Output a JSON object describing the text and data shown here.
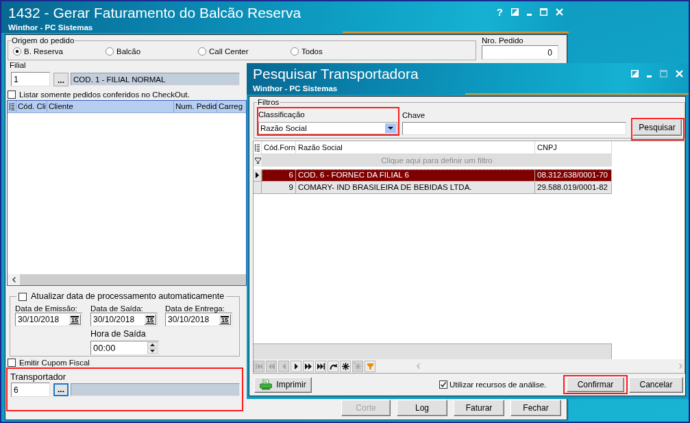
{
  "main_window": {
    "title": "1432 - Gerar Faturamento do Balcão Reserva",
    "subtitle": "Winthor - PC Sistemas",
    "controls": [
      {
        "kind": "help",
        "glyph": "?",
        "disabled": false
      },
      {
        "kind": "restore",
        "disabled": false
      },
      {
        "kind": "minimize",
        "disabled": false
      },
      {
        "kind": "maximize",
        "disabled": false
      },
      {
        "kind": "close",
        "disabled": false
      }
    ]
  },
  "origin": {
    "legend": "Origem do pedido",
    "options": [
      {
        "label": "B. Reserva",
        "selected": true
      },
      {
        "label": "Balcão",
        "selected": false
      },
      {
        "label": "Call Center",
        "selected": false
      },
      {
        "label": "Todos",
        "selected": false
      }
    ]
  },
  "order_number": {
    "label": "Nro. Pedido",
    "value": "0"
  },
  "branch": {
    "label": "Filial",
    "value": "1",
    "lookup": "...",
    "description": "COD. 1 - FILIAL NORMAL"
  },
  "checkout_filter": {
    "label": "Listar somente pedidos conferidos no CheckOut.",
    "checked": false
  },
  "orders_table": {
    "columns": [
      "Cód. Cli",
      "Cliente",
      "Num. Pedid",
      "Carreg"
    ]
  },
  "auto_dates": {
    "label": "Atualizar data de processamento automaticamente",
    "checked": false,
    "dates": [
      {
        "label": "Data de Emissão:",
        "value": "30/10/2018",
        "calendar": "15"
      },
      {
        "label": "Data de Saída:",
        "value": "30/10/2018",
        "calendar": "15"
      },
      {
        "label": "Data de Entrega:",
        "value": "30/10/2018",
        "calendar": "15"
      }
    ],
    "departure_time": {
      "label": "Hora de Saída",
      "value": "00:00"
    }
  },
  "fiscal_coupon": {
    "label": "Emitir Cupom Fiscal",
    "checked": false
  },
  "carrier": {
    "label": "Transportador",
    "value": "6",
    "lookup": "...",
    "lookup_focused": true,
    "highlighted": true
  },
  "buttons": [
    {
      "label": "Corte",
      "disabled": true
    },
    {
      "label": "Log",
      "disabled": false
    },
    {
      "label": "Faturar",
      "disabled": false
    },
    {
      "label": "Fechar",
      "disabled": false
    }
  ],
  "dialog": {
    "title": "Pesquisar Transportadora",
    "subtitle": "Winthor - PC Sistemas",
    "controls": [
      {
        "kind": "restore",
        "disabled": false
      },
      {
        "kind": "minimize",
        "disabled": false
      },
      {
        "kind": "maximize",
        "disabled": true
      },
      {
        "kind": "close",
        "disabled": false
      }
    ],
    "filters": {
      "legend": "Filtros",
      "classification": {
        "label": "Classificação",
        "value": "Razão Social",
        "highlighted": true
      },
      "key": {
        "label": "Chave"
      },
      "search_button": {
        "label": "Pesquisar",
        "highlighted": true
      }
    },
    "table": {
      "columns": [
        "Cód.Forn",
        "Razão Social",
        "CNPJ"
      ],
      "filter_hint": "Clique aqui para definir um filtro",
      "rows": [
        {
          "code": "6",
          "name": "COD. 6 - FORNEC DA FILIAL 6",
          "cnpj": "08.312.638/0001-70",
          "selected": true
        },
        {
          "code": "9",
          "name": "COMARY- IND BRASILEIRA DE BEBIDAS LTDA.",
          "cnpj": "29.588.019/0001-82",
          "selected": false
        }
      ]
    },
    "navigator": [
      {
        "kind": "first",
        "disabled": true
      },
      {
        "kind": "prior_page",
        "disabled": true
      },
      {
        "kind": "prior",
        "disabled": true
      },
      {
        "kind": "next",
        "disabled": false
      },
      {
        "kind": "next_page",
        "disabled": false
      },
      {
        "kind": "last",
        "disabled": false
      },
      {
        "kind": "refresh",
        "disabled": false
      },
      {
        "kind": "insert",
        "disabled": false
      },
      {
        "kind": "multi_insert",
        "disabled": true
      },
      {
        "kind": "filter",
        "disabled": false
      }
    ],
    "print_button": "Imprimir",
    "analysis": {
      "label": "Utilizar recursos de análise.",
      "checked": true
    },
    "buttons": [
      {
        "label": "Confirmar",
        "highlighted": true
      },
      {
        "label": "Cancelar",
        "highlighted": false
      }
    ]
  }
}
